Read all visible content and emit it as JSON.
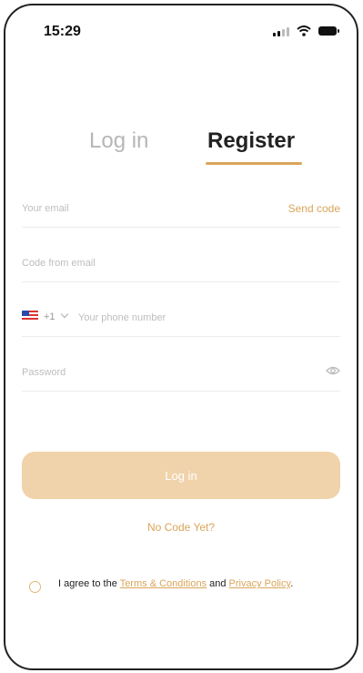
{
  "status_bar": {
    "time": "15:29"
  },
  "tabs": {
    "login": "Log in",
    "register": "Register"
  },
  "form": {
    "email_placeholder": "Your email",
    "send_code": "Send code",
    "code_placeholder": "Code from email",
    "country_code": "+1",
    "phone_placeholder": "Your phone number",
    "password_placeholder": "Password"
  },
  "login_button": "Log in",
  "no_code_link": "No Code Yet?",
  "agreement": {
    "prefix": "I agree to the ",
    "terms": "Terms & Conditions",
    "middle": " and ",
    "privacy": "Privacy Policy",
    "suffix": "."
  },
  "colors": {
    "accent": "#d9a55a",
    "button_bg": "#f0d3aa"
  }
}
